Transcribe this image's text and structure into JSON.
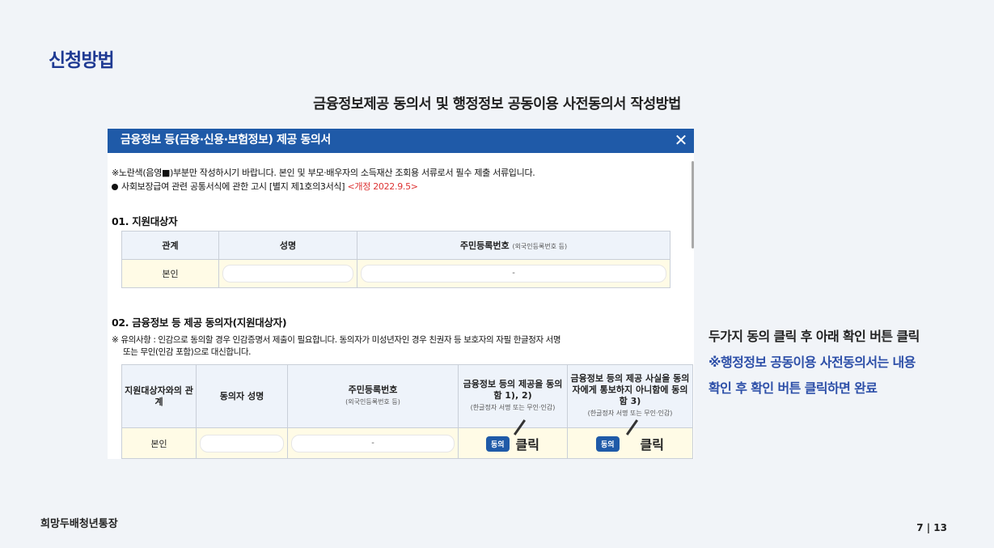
{
  "slide": {
    "title": "신청방법",
    "heading": "금융정보제공 동의서 및 행정정보 공동이용 사전동의서 작성방법",
    "footer_brand": "희망두배청년통장",
    "page_number": "7 | 13"
  },
  "form": {
    "window_title": "금융정보 등(금융·신용·보험정보) 제공 동의서",
    "close_label": "✕",
    "notice_line1": "※노란색(음영■)부분만 작성하시기 바랍니다. 본인 및 부모·배우자의 소득재산 조회용 서류로서 필수 제출 서류입니다.",
    "notice_line2": "사회보장급여 관련 공통서식에 관한 고시 [별지 제1호의3서식]",
    "notice_revised": "<개정 2022.9.5>",
    "section1": {
      "title": "01. 지원대상자",
      "headers": [
        "관계",
        "성명",
        "주민등록번호"
      ],
      "header_note": "(외국인등록번호 등)",
      "row_relation": "본인",
      "row_id_sep": "-"
    },
    "section2": {
      "title": "02. 금융정보 등 제공 동의자(지원대상자)",
      "caution_line1": "※ 유의사항 : 인감으로 동의할 경우 인감증명서 제출이 필요합니다. 동의자가 미성년자인 경우 친권자 등 보호자의 자필 한글정자 서명",
      "caution_line2": "또는 무인(인감 포함)으로 대신합니다.",
      "h_relation": "지원대상자와의 관계",
      "h_name": "동의자 성명",
      "h_id": "주민등록번호",
      "h_id_note": "(외국인등록번호 등)",
      "h_agree1": "금융정보 등의 제공을 동의함 1), 2)",
      "h_agree1_note": "(한글정자 서명 또는 무인·인감)",
      "h_agree2": "금융정보 등의 제공 사실을 동의자에게 통보하지 아니함에 동의함 3)",
      "h_agree2_note": "(한글정자 서명 또는 무인·인감)",
      "row_relation": "본인",
      "row_id_sep": "-",
      "agree_button": "동의",
      "click_label": "클릭"
    }
  },
  "side_note": {
    "line1": "두가지 동의 클릭 후 아래 확인 버튼 클릭",
    "line2": "※행정정보 공동이용 사전동의서는 내용",
    "line3": "확인 후 확인 버튼 클릭하면 완료"
  }
}
